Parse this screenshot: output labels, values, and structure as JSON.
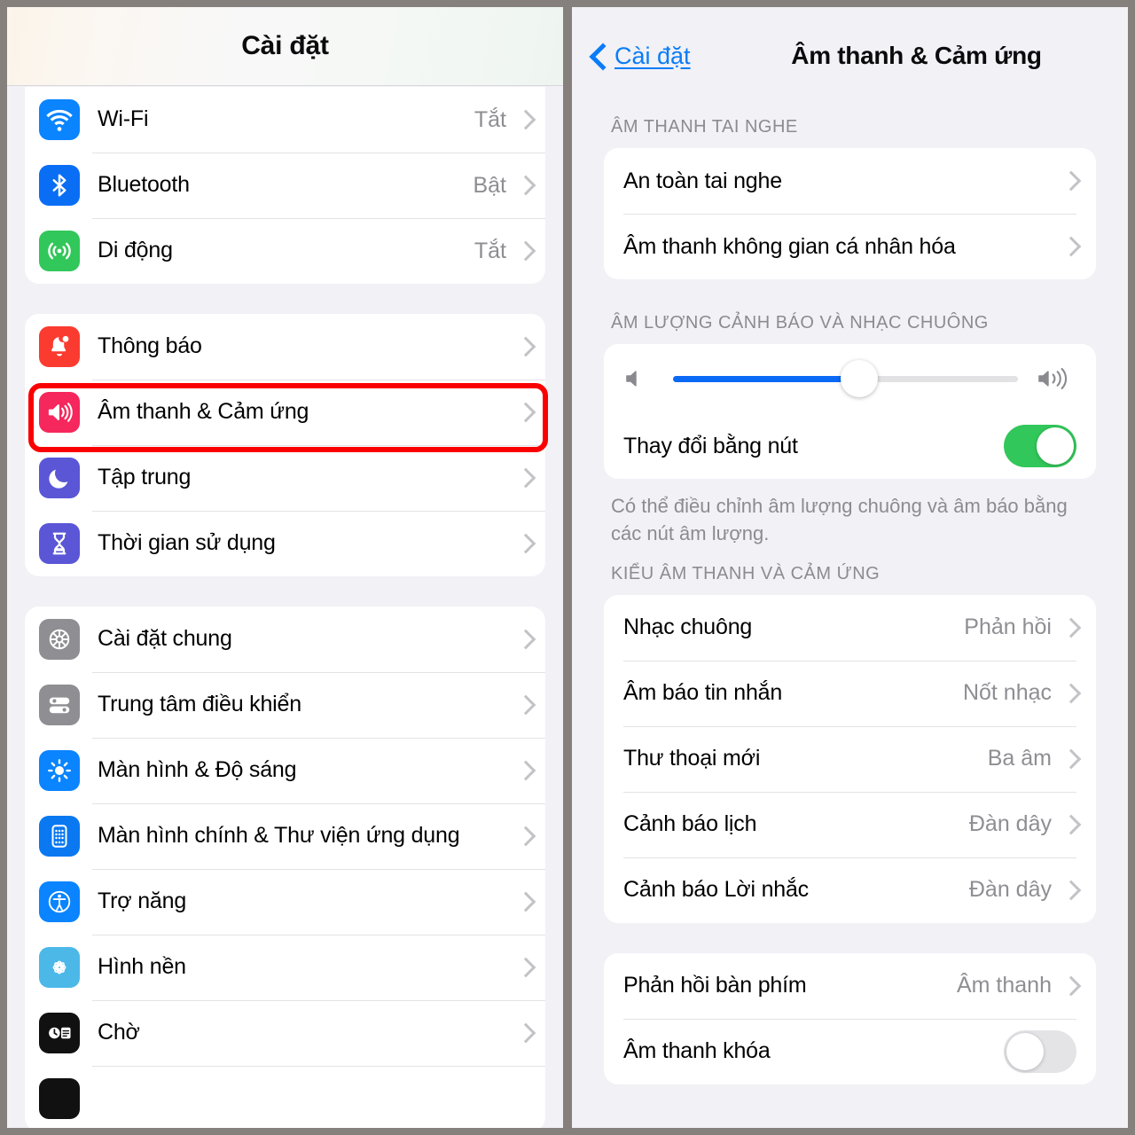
{
  "left_panel": {
    "header_title": "Cài đặt",
    "groups": [
      {
        "name": "connectivity",
        "rows": [
          {
            "label": "Wi-Fi",
            "value": "Tắt",
            "icon": "wifi-icon",
            "icon_bg": "#0a84ff"
          },
          {
            "label": "Bluetooth",
            "value": "Bật",
            "icon": "bluetooth-icon",
            "icon_bg": "#0a6ef5"
          },
          {
            "label": "Di động",
            "value": "Tắt",
            "icon": "cellular-icon",
            "icon_bg": "#32c75a"
          }
        ]
      },
      {
        "name": "alerts",
        "rows": [
          {
            "label": "Thông báo",
            "value": "",
            "icon": "bell-icon",
            "icon_bg": "#fb3b30"
          },
          {
            "label": "Âm thanh & Cảm ứng",
            "value": "",
            "icon": "speaker-icon",
            "icon_bg": "#f5275c"
          },
          {
            "label": "Tập trung",
            "value": "",
            "icon": "moon-icon",
            "icon_bg": "#5a56d6"
          },
          {
            "label": "Thời gian sử dụng",
            "value": "",
            "icon": "hourglass-icon",
            "icon_bg": "#5a56d6"
          }
        ]
      },
      {
        "name": "system",
        "rows": [
          {
            "label": "Cài đặt chung",
            "value": "",
            "icon": "gear-icon",
            "icon_bg": "#8e8e93"
          },
          {
            "label": "Trung tâm điều khiển",
            "value": "",
            "icon": "sliders-icon",
            "icon_bg": "#8e8e93"
          },
          {
            "label": "Màn hình & Độ sáng",
            "value": "",
            "icon": "brightness-icon",
            "icon_bg": "#0a84ff"
          },
          {
            "label": "Màn hình chính & Thư viện ứng dụng",
            "value": "",
            "icon": "app-grid-icon",
            "icon_bg": "#0a78f0"
          },
          {
            "label": "Trợ năng",
            "value": "",
            "icon": "accessibility-icon",
            "icon_bg": "#0a84ff"
          },
          {
            "label": "Hình nền",
            "value": "",
            "icon": "wallpaper-icon",
            "icon_bg": "#4cb8e8"
          },
          {
            "label": "Chờ",
            "value": "",
            "icon": "standby-icon",
            "icon_bg": "#111111"
          }
        ]
      }
    ]
  },
  "right_panel": {
    "back_label": "Cài đặt",
    "back_icon": "chevron-left-icon",
    "title": "Âm thanh & Cảm ứng",
    "section_headphone": {
      "header": "ÂM THANH TAI NGHE",
      "rows": [
        {
          "label": "An toàn tai nghe",
          "value": ""
        },
        {
          "label": "Âm thanh không gian cá nhân hóa",
          "value": ""
        }
      ]
    },
    "section_volume": {
      "header": "ÂM LƯỢNG CẢNH BÁO VÀ NHẠC CHUÔNG",
      "slider": {
        "name": "ringer-volume-slider",
        "percent": 54,
        "left_icon": "speaker-low-icon",
        "right_icon": "speaker-high-icon"
      },
      "toggle_row": {
        "label": "Thay đổi bằng nút",
        "state": "on"
      },
      "footnote": "Có thể điều chỉnh âm lượng chuông và âm báo bằng các nút âm lượng."
    },
    "section_tones": {
      "header": "KIỂU ÂM THANH VÀ CẢM ỨNG",
      "rows": [
        {
          "label": "Nhạc chuông",
          "value": "Phản hồi"
        },
        {
          "label": "Âm báo tin nhắn",
          "value": "Nốt nhạc"
        },
        {
          "label": "Thư thoại mới",
          "value": "Ba âm"
        },
        {
          "label": "Cảnh báo lịch",
          "value": "Đàn dây"
        },
        {
          "label": "Cảnh báo Lời nhắc",
          "value": "Đàn dây"
        }
      ]
    },
    "section_keyboard": {
      "rows": [
        {
          "label": "Phản hồi bàn phím",
          "value": "Âm thanh"
        }
      ],
      "toggle_row": {
        "label": "Âm thanh khóa",
        "state": "off"
      }
    }
  },
  "highlights": {
    "color": "#fb0000",
    "left_target": "Âm thanh & Cảm ứng",
    "right_target": "Nhạc chuông"
  }
}
